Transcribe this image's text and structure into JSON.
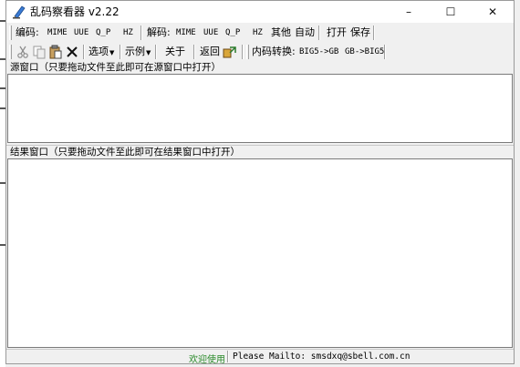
{
  "window": {
    "title": "乱码察看器 v2.22",
    "controls": {
      "minimize": "–",
      "maximize": "☐",
      "close": "✕"
    }
  },
  "toolbar1": {
    "encode_label": "编码:",
    "encode_mime": "MIME",
    "encode_uue": "UUE",
    "encode_qp": "Q_P",
    "encode_hz": "HZ",
    "decode_label": "解码:",
    "decode_mime": "MIME",
    "decode_uue": "UUE",
    "decode_qp": "Q_P",
    "decode_hz": "HZ",
    "decode_other": "其他",
    "decode_auto": "自动",
    "open": "打开",
    "save": "保存"
  },
  "toolbar2": {
    "cut_icon": "scissors-icon",
    "copy_icon": "copy-icon",
    "paste_icon": "paste-icon",
    "delete_icon": "delete-x-icon",
    "options": "选项",
    "examples": "示例",
    "about": "关于",
    "back": "返回",
    "convert_label": "内码转换:",
    "big5_to_gb": "BIG5->GB",
    "gb_to_big5": "GB->BIG5"
  },
  "source_pane": {
    "label": "源窗口（只要拖动文件至此即可在源窗口中打开）"
  },
  "result_pane": {
    "label": "结果窗口（只要拖动文件至此即可在结果窗口中打开）"
  },
  "status": {
    "welcome": "欢迎使用",
    "mail": "Please Mailto: smsdxq@sbell.com.cn"
  },
  "colors": {
    "welcome_text": "#2a8a2a",
    "pane_bg": "#ffffff",
    "chrome_bg": "#f0f0f0"
  }
}
